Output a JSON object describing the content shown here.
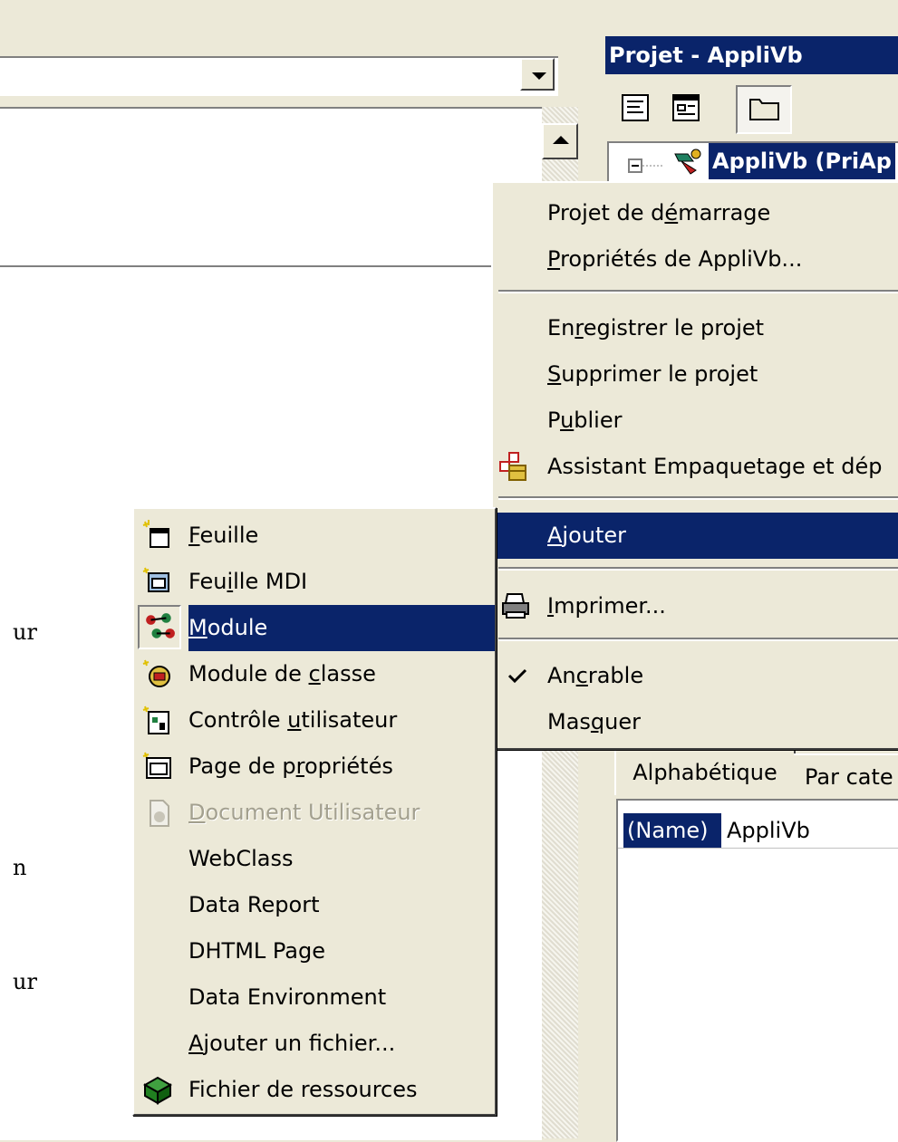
{
  "code_window": {
    "fragments": [
      "ur",
      "n",
      "ur"
    ]
  },
  "project_explorer": {
    "title": "Projet - AppliVb",
    "tree_node": "AppliVb (PriAp"
  },
  "context_menu": {
    "items": [
      {
        "pre": "Projet de d",
        "acc": "é",
        "post": "marrage"
      },
      {
        "pre": "",
        "acc": "P",
        "post": "ropriétés de AppliVb..."
      },
      {
        "pre": "En",
        "acc": "r",
        "post": "egistrer le projet"
      },
      {
        "pre": "",
        "acc": "S",
        "post": "upprimer le projet"
      },
      {
        "pre": "P",
        "acc": "u",
        "post": "blier"
      },
      {
        "pre": "Assistant Empaquetage et dép",
        "acc": "",
        "post": ""
      },
      {
        "pre": "",
        "acc": "A",
        "post": "jouter"
      },
      {
        "pre": "",
        "acc": "I",
        "post": "mprimer..."
      },
      {
        "pre": "An",
        "acc": "c",
        "post": "rable"
      },
      {
        "pre": "Mas",
        "acc": "q",
        "post": "uer"
      }
    ]
  },
  "submenu": {
    "items": [
      {
        "pre": "",
        "acc": "F",
        "post": "euille"
      },
      {
        "pre": "Feu",
        "acc": "i",
        "post": "lle MDI"
      },
      {
        "pre": "",
        "acc": "M",
        "post": "odule"
      },
      {
        "pre": "Module de ",
        "acc": "c",
        "post": "lasse"
      },
      {
        "pre": "Contrôle ",
        "acc": "u",
        "post": "tilisateur"
      },
      {
        "pre": "Page de p",
        "acc": "r",
        "post": "opriétés"
      },
      {
        "pre": "",
        "acc": "D",
        "post": "ocument Utilisateur"
      },
      {
        "pre": "WebClass",
        "acc": "",
        "post": ""
      },
      {
        "pre": "Data Report",
        "acc": "",
        "post": ""
      },
      {
        "pre": "DHTML Page",
        "acc": "",
        "post": ""
      },
      {
        "pre": "Data Environment",
        "acc": "",
        "post": ""
      },
      {
        "pre": "",
        "acc": "A",
        "post": "jouter un fichier..."
      },
      {
        "pre": "Fichier de ressources",
        "acc": "",
        "post": ""
      }
    ]
  },
  "properties": {
    "tab_alpha": "Alphabétique",
    "tab_cat": "Par cate",
    "prop_name": "(Name)",
    "prop_value": "AppliVb"
  },
  "colors": {
    "highlight": "#0a246a",
    "face": "#ece9d8",
    "disabled": "#a3a08f"
  }
}
